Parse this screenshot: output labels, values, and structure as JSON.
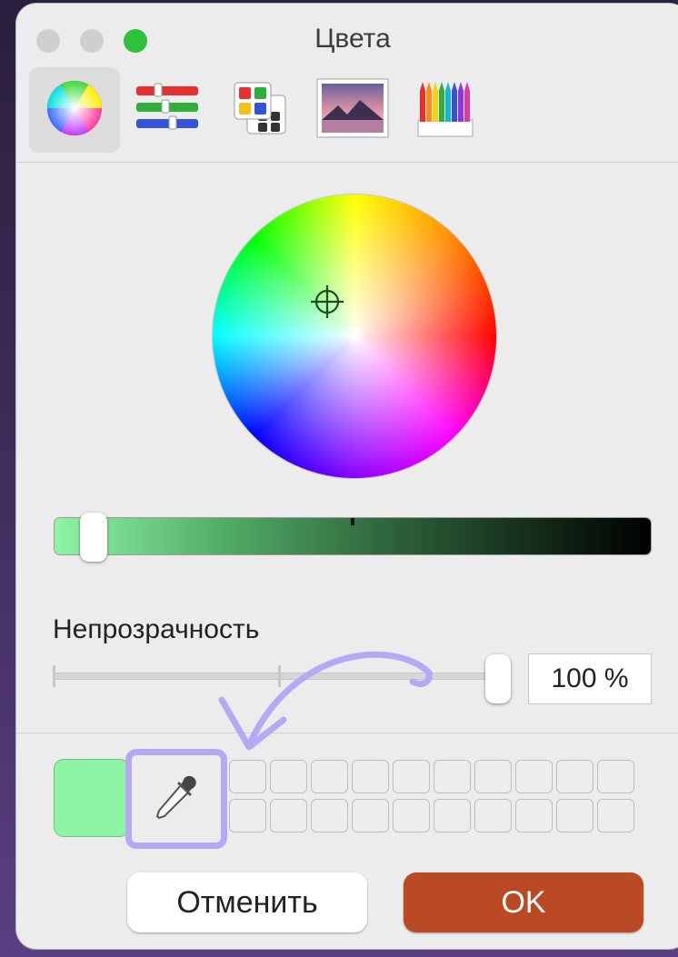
{
  "window": {
    "title": "Цвета"
  },
  "toolbar": {
    "tools": [
      {
        "icon": "color-wheel-icon"
      },
      {
        "icon": "color-sliders-icon"
      },
      {
        "icon": "color-palettes-icon"
      },
      {
        "icon": "image-palettes-icon"
      },
      {
        "icon": "pencils-icon"
      }
    ]
  },
  "opacity": {
    "label": "Непрозрачность",
    "value_text": "100 %",
    "value": 1.0
  },
  "brightness": {
    "value": 0.95
  },
  "current_color": {
    "hex": "#8ef5a4"
  },
  "colors": {
    "accent_ok": "#b94a24",
    "highlight": "#b7a8f4"
  },
  "buttons": {
    "cancel": "Отменить",
    "ok": "OK"
  }
}
